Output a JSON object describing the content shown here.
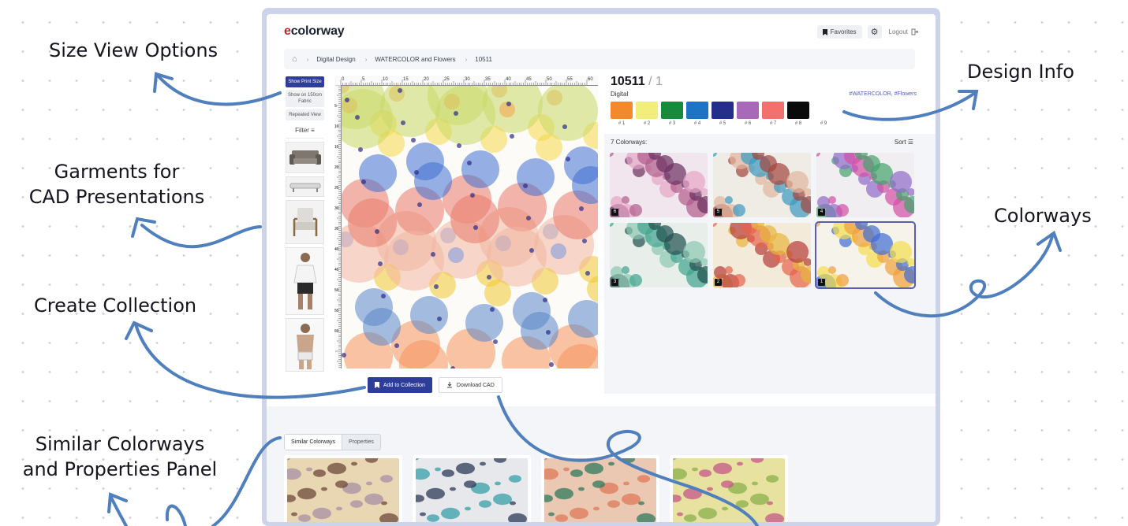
{
  "callouts": {
    "size_view": "Size View Options",
    "garments_1": "Garments for",
    "garments_2": "CAD Presentations",
    "create_collection": "Create Collection",
    "similar_1": "Similar Colorways",
    "similar_2": "and Properties Panel",
    "design_info": "Design Info",
    "colorways": "Colorways"
  },
  "header": {
    "logo_prefix": "e",
    "logo_rest": "colorway",
    "favorites": "Favorites",
    "logout": "Logout"
  },
  "breadcrumb": [
    "Digital Design",
    "WATERCOLOR and Flowers",
    "10511"
  ],
  "view_options": [
    "Show Print Size",
    "Show on 150cm Fabric",
    "Repeated View"
  ],
  "filter_label": "Filter",
  "garments": [
    "sofa",
    "bench",
    "armchair",
    "shirt model",
    "swimwear model"
  ],
  "ruler_marks": [
    "0",
    "5",
    "10",
    "15",
    "20",
    "25",
    "30",
    "35",
    "40",
    "45",
    "50",
    "55",
    "60"
  ],
  "ruler_left_marks": [
    "5",
    "10",
    "15",
    "20",
    "25",
    "30",
    "35",
    "40",
    "45",
    "50",
    "55",
    "60"
  ],
  "actions": {
    "add": "Add to Collection",
    "download": "Download CAD"
  },
  "design": {
    "code": "10511",
    "count": "1",
    "category": "Digital",
    "tags": "#WATERCOLOR, #Flowers",
    "swatches": [
      {
        "label": "# 1",
        "color": "#f28a2b"
      },
      {
        "label": "# 2",
        "color": "#f1ee7c"
      },
      {
        "label": "# 3",
        "color": "#178a3b"
      },
      {
        "label": "# 4",
        "color": "#1d74c4"
      },
      {
        "label": "# 5",
        "color": "#262e8c"
      },
      {
        "label": "# 6",
        "color": "#a969b9"
      },
      {
        "label": "# 7",
        "color": "#f2706e"
      },
      {
        "label": "# 8",
        "color": "#0a0a0a"
      },
      {
        "label": "# 9",
        "color": "#ffffff"
      }
    ]
  },
  "colorways": {
    "title": "7 Colorways:",
    "sort": "Sort",
    "items": [
      {
        "badge": "6",
        "bg": "#f1e6ee",
        "a": "#b05b8b",
        "b": "#6b2e5f",
        "c": "#e5a4c4"
      },
      {
        "badge": "5",
        "bg": "#efece6",
        "a": "#3a9ac0",
        "b": "#a3443a",
        "c": "#e1b79e"
      },
      {
        "badge": "4",
        "bg": "#f0eef1",
        "a": "#d34ea5",
        "b": "#42a36b",
        "c": "#8e6bc9"
      },
      {
        "badge": "3",
        "bg": "#e8eee9",
        "a": "#3fa48f",
        "b": "#1e4f4c",
        "c": "#8cc7b2"
      },
      {
        "badge": "2",
        "bg": "#f3ead9",
        "a": "#e5624a",
        "b": "#e8b53b",
        "c": "#b73b3b"
      },
      {
        "badge": "1",
        "bg": "#f5f3ea",
        "a": "#f0a03c",
        "b": "#3e6bd1",
        "c": "#f3dd4c"
      }
    ]
  },
  "bottom": {
    "tabs": [
      "Similar Colorways",
      "Properties"
    ],
    "similar": [
      {
        "bg": "#e9d6b3",
        "a": "#6b4a3a",
        "b": "#a88fa6"
      },
      {
        "bg": "#e6e8ec",
        "a": "#2c3a55",
        "b": "#38a0a8"
      },
      {
        "bg": "#eac8b2",
        "a": "#2f7a5b",
        "b": "#e07a5a"
      },
      {
        "bg": "#e8e2a0",
        "a": "#c7568a",
        "b": "#8ab04a"
      }
    ]
  }
}
